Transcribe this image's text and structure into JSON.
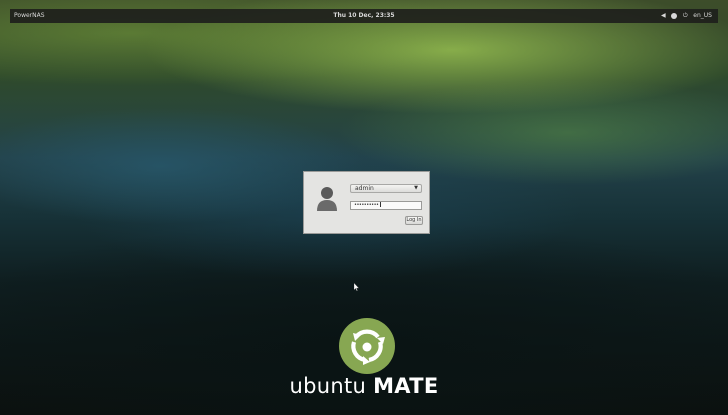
{
  "top_panel": {
    "host_name": "PowerNAS",
    "clock": "Thu 10 Dec, 23:35",
    "keyboard_layout": "en_US",
    "icons": [
      "sound-icon",
      "accessibility-icon",
      "power-icon"
    ]
  },
  "login": {
    "username": "admin",
    "password_mask": "••••••••••",
    "login_button": "Log In"
  },
  "brand": {
    "name_light": "ubuntu",
    "name_bold": "MATE",
    "accent_color": "#87a752"
  }
}
